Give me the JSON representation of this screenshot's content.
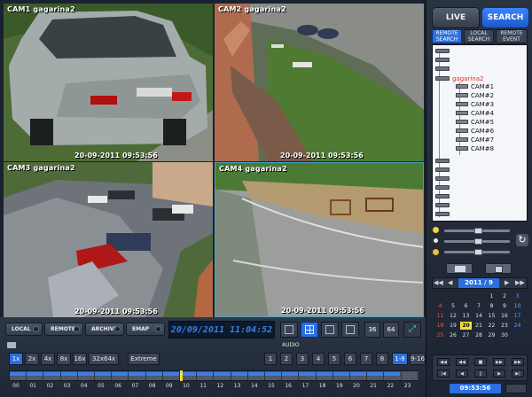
{
  "cameras": [
    {
      "label": "CAM1  gagarina2",
      "timestamp": "20-09-2011 09:53:56"
    },
    {
      "label": "CAM2  gagarina2",
      "timestamp": "20-09-2011 09:53:56"
    },
    {
      "label": "CAM3  gagarina2",
      "timestamp": "20-09-2011 09:53:56"
    },
    {
      "label": "CAM4  gagarina2",
      "timestamp": "20-09-2011 09:53:56"
    }
  ],
  "mode_tabs": {
    "live": "LIVE",
    "search": "SEARCH"
  },
  "search_tabs": [
    {
      "label": "REMOTE SEARCH",
      "active": true
    },
    {
      "label": "LOCAL SEARCH",
      "active": false
    },
    {
      "label": "REMOTE EVENT",
      "active": false
    }
  ],
  "tree": {
    "site": "gagarina2",
    "other_sites": [
      "",
      "",
      "",
      "",
      "",
      "",
      "",
      "",
      "",
      "",
      "",
      "",
      "",
      "",
      "",
      ""
    ],
    "cameras": [
      "CAM#1",
      "CAM#2",
      "CAM#3",
      "CAM#4",
      "CAM#5",
      "CAM#6",
      "CAM#7",
      "CAM#8"
    ]
  },
  "calendar": {
    "month_label": "2011 / 9",
    "days": [
      [
        "",
        "",
        "",
        "",
        "1",
        "2",
        "3"
      ],
      [
        "4",
        "5",
        "6",
        "7",
        "8",
        "9",
        "10"
      ],
      [
        "11",
        "12",
        "13",
        "14",
        "15",
        "16",
        "17"
      ],
      [
        "18",
        "19",
        "20",
        "21",
        "22",
        "23",
        "24"
      ],
      [
        "25",
        "26",
        "27",
        "28",
        "29",
        "30",
        ""
      ]
    ],
    "selected": "20"
  },
  "clock": "09:53:56",
  "toolbar": {
    "local": "LOCAL",
    "remote": "REMOTE",
    "archive": "ARCHIVE",
    "emap": "EMAP",
    "datetime": "20/09/2011 11:04:52",
    "split16": "36",
    "split64": "64",
    "audio": "AUDIO",
    "speeds": [
      "1x",
      "2x",
      "4x",
      "8x",
      "16x",
      "32x",
      "64x",
      "Extreme"
    ],
    "active_speed": "1x",
    "audio_channels": [
      "1",
      "2",
      "3",
      "4",
      "5",
      "6",
      "7",
      "8",
      "1-8",
      "9-16"
    ],
    "active_audio": "1-8",
    "hours": [
      "00",
      "01",
      "02",
      "03",
      "04",
      "05",
      "06",
      "07",
      "08",
      "09",
      "10",
      "11",
      "12",
      "13",
      "14",
      "15",
      "16",
      "17",
      "18",
      "19",
      "20",
      "21",
      "22",
      "23"
    ]
  },
  "colors": {
    "accent_blue": "#2b6fe0",
    "recording_blue": "#3d7de6",
    "date_green": "#b8f84a",
    "selected_red": "#e03020",
    "playhead_yellow": "#f0e040"
  }
}
